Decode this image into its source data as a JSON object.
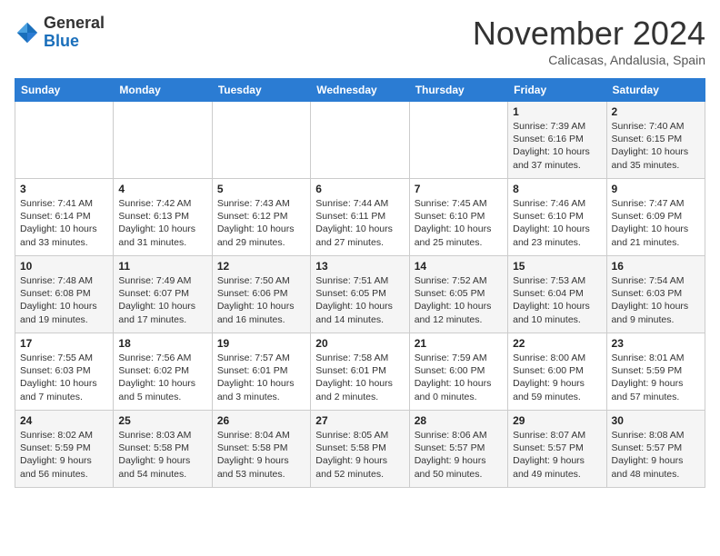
{
  "header": {
    "logo": {
      "line1": "General",
      "line2": "Blue"
    },
    "title": "November 2024",
    "location": "Calicasas, Andalusia, Spain"
  },
  "columns": [
    "Sunday",
    "Monday",
    "Tuesday",
    "Wednesday",
    "Thursday",
    "Friday",
    "Saturday"
  ],
  "rows": [
    [
      {
        "day": "",
        "info": ""
      },
      {
        "day": "",
        "info": ""
      },
      {
        "day": "",
        "info": ""
      },
      {
        "day": "",
        "info": ""
      },
      {
        "day": "",
        "info": ""
      },
      {
        "day": "1",
        "info": "Sunrise: 7:39 AM\nSunset: 6:16 PM\nDaylight: 10 hours and 37 minutes."
      },
      {
        "day": "2",
        "info": "Sunrise: 7:40 AM\nSunset: 6:15 PM\nDaylight: 10 hours and 35 minutes."
      }
    ],
    [
      {
        "day": "3",
        "info": "Sunrise: 7:41 AM\nSunset: 6:14 PM\nDaylight: 10 hours and 33 minutes."
      },
      {
        "day": "4",
        "info": "Sunrise: 7:42 AM\nSunset: 6:13 PM\nDaylight: 10 hours and 31 minutes."
      },
      {
        "day": "5",
        "info": "Sunrise: 7:43 AM\nSunset: 6:12 PM\nDaylight: 10 hours and 29 minutes."
      },
      {
        "day": "6",
        "info": "Sunrise: 7:44 AM\nSunset: 6:11 PM\nDaylight: 10 hours and 27 minutes."
      },
      {
        "day": "7",
        "info": "Sunrise: 7:45 AM\nSunset: 6:10 PM\nDaylight: 10 hours and 25 minutes."
      },
      {
        "day": "8",
        "info": "Sunrise: 7:46 AM\nSunset: 6:10 PM\nDaylight: 10 hours and 23 minutes."
      },
      {
        "day": "9",
        "info": "Sunrise: 7:47 AM\nSunset: 6:09 PM\nDaylight: 10 hours and 21 minutes."
      }
    ],
    [
      {
        "day": "10",
        "info": "Sunrise: 7:48 AM\nSunset: 6:08 PM\nDaylight: 10 hours and 19 minutes."
      },
      {
        "day": "11",
        "info": "Sunrise: 7:49 AM\nSunset: 6:07 PM\nDaylight: 10 hours and 17 minutes."
      },
      {
        "day": "12",
        "info": "Sunrise: 7:50 AM\nSunset: 6:06 PM\nDaylight: 10 hours and 16 minutes."
      },
      {
        "day": "13",
        "info": "Sunrise: 7:51 AM\nSunset: 6:05 PM\nDaylight: 10 hours and 14 minutes."
      },
      {
        "day": "14",
        "info": "Sunrise: 7:52 AM\nSunset: 6:05 PM\nDaylight: 10 hours and 12 minutes."
      },
      {
        "day": "15",
        "info": "Sunrise: 7:53 AM\nSunset: 6:04 PM\nDaylight: 10 hours and 10 minutes."
      },
      {
        "day": "16",
        "info": "Sunrise: 7:54 AM\nSunset: 6:03 PM\nDaylight: 10 hours and 9 minutes."
      }
    ],
    [
      {
        "day": "17",
        "info": "Sunrise: 7:55 AM\nSunset: 6:03 PM\nDaylight: 10 hours and 7 minutes."
      },
      {
        "day": "18",
        "info": "Sunrise: 7:56 AM\nSunset: 6:02 PM\nDaylight: 10 hours and 5 minutes."
      },
      {
        "day": "19",
        "info": "Sunrise: 7:57 AM\nSunset: 6:01 PM\nDaylight: 10 hours and 3 minutes."
      },
      {
        "day": "20",
        "info": "Sunrise: 7:58 AM\nSunset: 6:01 PM\nDaylight: 10 hours and 2 minutes."
      },
      {
        "day": "21",
        "info": "Sunrise: 7:59 AM\nSunset: 6:00 PM\nDaylight: 10 hours and 0 minutes."
      },
      {
        "day": "22",
        "info": "Sunrise: 8:00 AM\nSunset: 6:00 PM\nDaylight: 9 hours and 59 minutes."
      },
      {
        "day": "23",
        "info": "Sunrise: 8:01 AM\nSunset: 5:59 PM\nDaylight: 9 hours and 57 minutes."
      }
    ],
    [
      {
        "day": "24",
        "info": "Sunrise: 8:02 AM\nSunset: 5:59 PM\nDaylight: 9 hours and 56 minutes."
      },
      {
        "day": "25",
        "info": "Sunrise: 8:03 AM\nSunset: 5:58 PM\nDaylight: 9 hours and 54 minutes."
      },
      {
        "day": "26",
        "info": "Sunrise: 8:04 AM\nSunset: 5:58 PM\nDaylight: 9 hours and 53 minutes."
      },
      {
        "day": "27",
        "info": "Sunrise: 8:05 AM\nSunset: 5:58 PM\nDaylight: 9 hours and 52 minutes."
      },
      {
        "day": "28",
        "info": "Sunrise: 8:06 AM\nSunset: 5:57 PM\nDaylight: 9 hours and 50 minutes."
      },
      {
        "day": "29",
        "info": "Sunrise: 8:07 AM\nSunset: 5:57 PM\nDaylight: 9 hours and 49 minutes."
      },
      {
        "day": "30",
        "info": "Sunrise: 8:08 AM\nSunset: 5:57 PM\nDaylight: 9 hours and 48 minutes."
      }
    ]
  ]
}
